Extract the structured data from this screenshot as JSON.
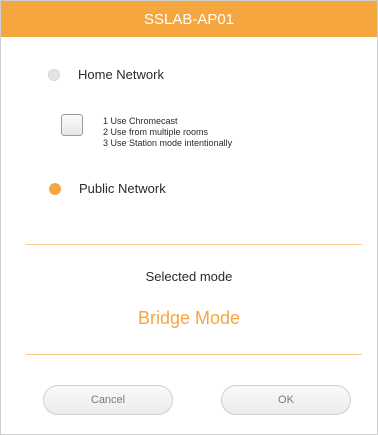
{
  "dialog": {
    "title": "SSLAB-AP01"
  },
  "network_options": {
    "home": {
      "label": "Home Network",
      "selected": false
    },
    "public": {
      "label": "Public Network",
      "selected": true
    }
  },
  "home_checkbox": {
    "checked": false,
    "reasons": [
      "1 Use Chromecast",
      "2 Use from multiple rooms",
      "3 Use Station mode intentionally"
    ]
  },
  "mode": {
    "caption": "Selected mode",
    "value": "Bridge Mode"
  },
  "buttons": {
    "cancel": "Cancel",
    "ok": "OK"
  },
  "colors": {
    "accent": "#f6a63e",
    "text": "#2a2a2a",
    "button_text": "#7a7a7a"
  }
}
